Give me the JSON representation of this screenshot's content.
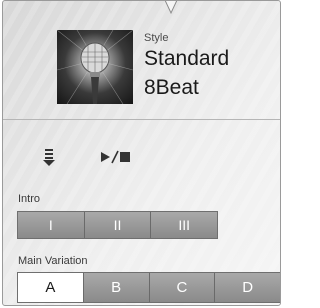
{
  "style": {
    "section_label": "Style",
    "name_line1": "Standard",
    "name_line2": "8Beat",
    "thumbnail_icon": "microphone-image"
  },
  "controls": {
    "load_icon": "load-down-arrow-icon",
    "play_stop_icon": "play-stop-icon"
  },
  "intro": {
    "label": "Intro",
    "buttons": [
      "I",
      "II",
      "III"
    ]
  },
  "main_variation": {
    "label": "Main Variation",
    "buttons": [
      "A",
      "B",
      "C",
      "D"
    ],
    "selected": "A"
  },
  "colors": {
    "panel_bg": "#e6e6e6",
    "button_bg": "#9a9a9a",
    "selected_bg": "#ffffff"
  }
}
